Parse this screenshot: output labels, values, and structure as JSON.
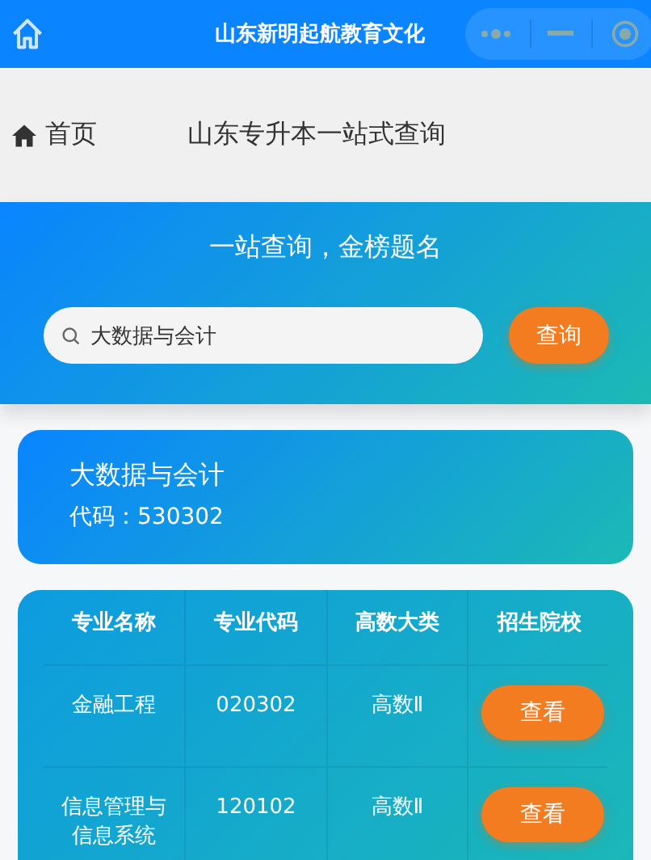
{
  "header": {
    "title": "山东新明起航教育文化"
  },
  "breadcrumb": {
    "home": "首页",
    "title": "山东专升本一站式查询"
  },
  "hero": {
    "slogan": "一站查询，金榜题名",
    "search": {
      "value": "大数据与会计"
    },
    "button": "查询"
  },
  "major": {
    "name": "大数据与会计",
    "code": "代码：530302"
  },
  "table": {
    "columns": [
      "专业名称",
      "专业代码",
      "高数大类",
      "招生院校"
    ],
    "rows": [
      {
        "name": "金融工程",
        "code": "020302",
        "math": "高数Ⅱ",
        "action": "查看"
      },
      {
        "name": "信息管理与信息系统",
        "code": "120102",
        "math": "高数Ⅱ",
        "action": "查看"
      }
    ]
  }
}
